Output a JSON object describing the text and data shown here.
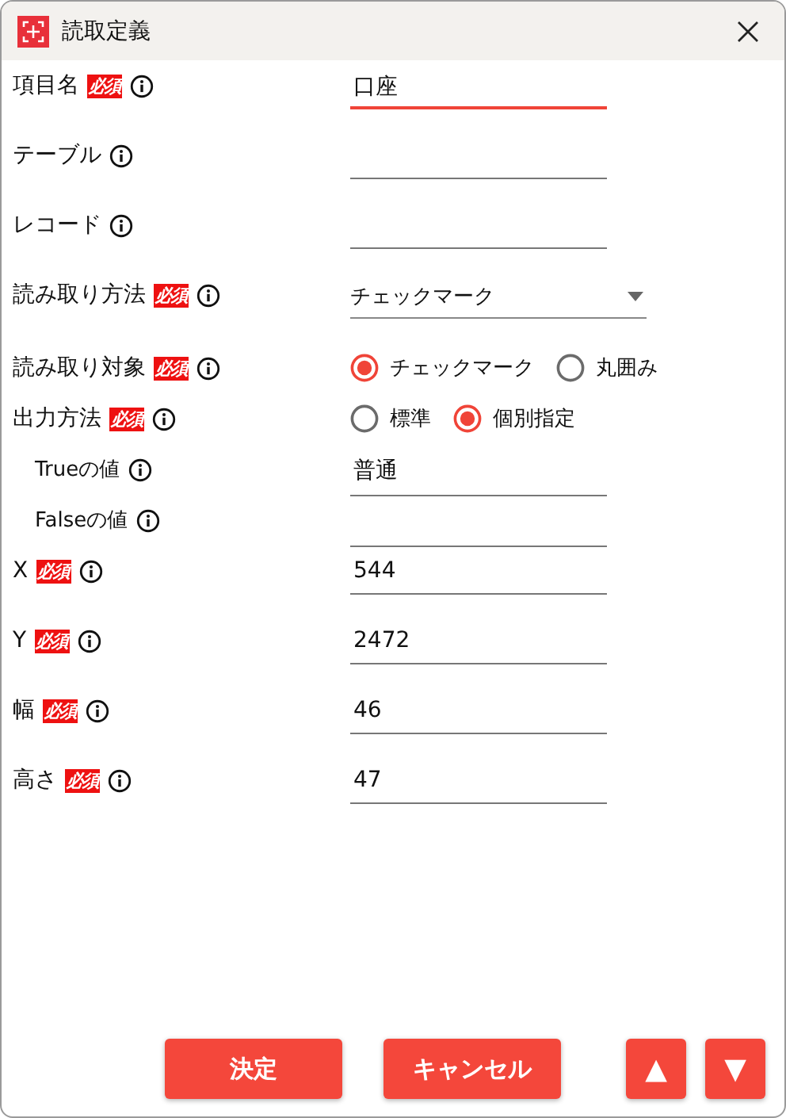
{
  "window": {
    "title": "読取定義"
  },
  "fields": [
    {
      "label": "項目名",
      "badge": "必須",
      "indent": false,
      "kind": "text",
      "value": "口座",
      "focused": true
    },
    {
      "label": "テーブル",
      "indent": false,
      "kind": "text",
      "focused": false
    },
    {
      "label": "レコード",
      "indent": false,
      "kind": "text",
      "focused": false
    },
    {
      "label": "読み取り方法",
      "badge": "必須",
      "indent": false,
      "kind": "select",
      "value": "チェックマーク"
    },
    {
      "label": "読み取り対象",
      "badge": "必須",
      "indent": false,
      "kind": "radio",
      "options": [
        {
          "label": "チェックマーク",
          "selected": true
        },
        {
          "label": "丸囲み",
          "selected": false
        }
      ]
    },
    {
      "label": "出力方法",
      "badge": "必須",
      "indent": false,
      "kind": "radio",
      "options": [
        {
          "label": "標準",
          "selected": false
        },
        {
          "label": "個別指定",
          "selected": true
        }
      ]
    },
    {
      "label": "Trueの値",
      "indent": true,
      "kind": "text",
      "value": "普通",
      "focused": false
    },
    {
      "label": "Falseの値",
      "indent": true,
      "kind": "text",
      "focused": false
    },
    {
      "label": "X",
      "badge": "必須",
      "indent": false,
      "kind": "text",
      "value": "544",
      "focused": false
    },
    {
      "label": "Y",
      "badge": "必須",
      "indent": false,
      "kind": "text",
      "value": "2472",
      "focused": false
    },
    {
      "label": "幅",
      "badge": "必須",
      "indent": false,
      "kind": "text",
      "value": "46",
      "focused": false
    },
    {
      "label": "高さ",
      "badge": "必須",
      "indent": false,
      "kind": "text",
      "value": "47",
      "focused": false
    }
  ],
  "buttons": [
    {
      "label": "決定"
    },
    {
      "label": "キャンセル"
    }
  ],
  "arrows": [
    {
      "label": "▲"
    },
    {
      "label": "▼"
    }
  ]
}
